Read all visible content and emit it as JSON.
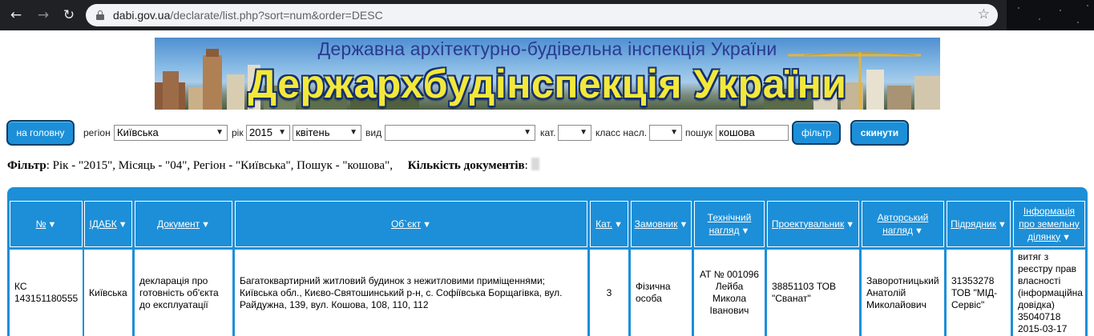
{
  "browser": {
    "url_host": "dabi.gov.ua",
    "url_path": "/declarate/list.php?sort=num&order=DESC"
  },
  "banner": {
    "subtitle": "Державна архітектурно-будівельна інспекція України",
    "title": "Держархбудінспекція України"
  },
  "filters": {
    "home_button": "на головну",
    "region_label": "регіон",
    "region_value": "Київська",
    "year_label": "рік",
    "year_value": "2015",
    "month_value": "квітень",
    "type_label": "вид",
    "type_value": "",
    "category_label": "кат.",
    "category_value": "",
    "class_label": "класс насл.",
    "class_value": "",
    "search_label": "пошук",
    "search_value": "кошова",
    "filter_button": "фільтр",
    "reset_button": "скинути"
  },
  "filter_summary": {
    "filter_caption": "Фільтр",
    "filter_text": ": Рік - \"2015\", Місяць - \"04\", Регіон - \"Київська\", Пошук - \"кошова\",",
    "count_caption": "Кількість документів",
    "count_suffix": ":"
  },
  "table": {
    "sort_arrow": "▼",
    "headers": [
      [
        "№"
      ],
      [
        "ІДАБК"
      ],
      [
        "Документ"
      ],
      [
        "Об`єкт"
      ],
      [
        "Кат."
      ],
      [
        "Замовник"
      ],
      [
        "Технічний",
        "нагляд"
      ],
      [
        "Проектувальник"
      ],
      [
        "Авторський",
        "нагляд"
      ],
      [
        "Підрядник"
      ],
      [
        "Інформація",
        "про земельну",
        "ділянку"
      ]
    ],
    "row": [
      "КС 143151180555",
      "Київська",
      "декларація про готовність об'єкта до експлуатації",
      "Багатоквартирний житловий будинок з нежитловими приміщеннями; Київська обл., Києво-Святошинський р-н, с. Софіївська Борщагівка, вул. Райдужна, 139, вул. Кошова, 108, 110, 112",
      "3",
      "Фізична особа",
      "АТ № 001096 Лейба Микола Іванович",
      "38851103 ТОВ \"Сванат\"",
      "Заворотницький Анатолій Миколайович",
      "31353278 ТОВ \"МІД-Сервіс\"",
      "витяг з реєстру прав власності (інформаційна довідка) 35040718 2015-03-17"
    ]
  }
}
